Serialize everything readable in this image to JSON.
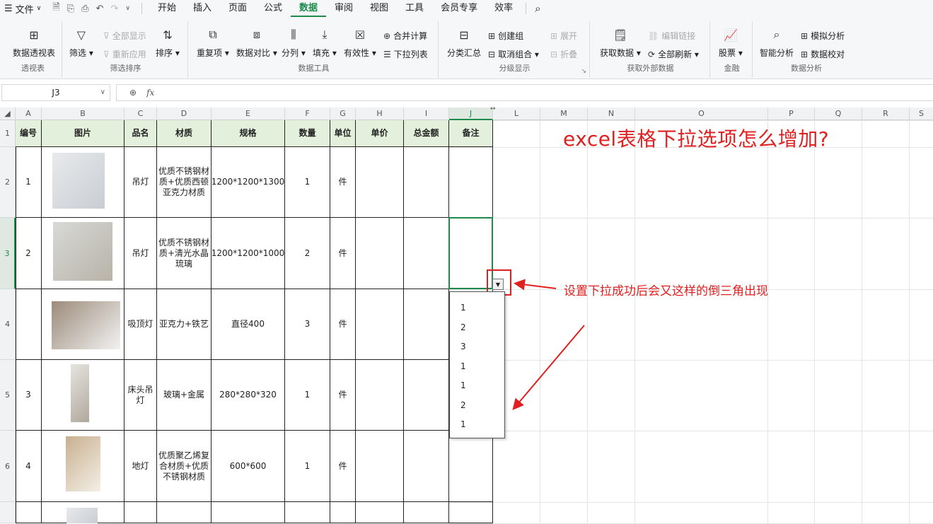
{
  "menubar": {
    "file_label": "文件",
    "tabs": [
      {
        "label": "开始",
        "active": false
      },
      {
        "label": "插入",
        "active": false
      },
      {
        "label": "页面",
        "active": false
      },
      {
        "label": "公式",
        "active": false
      },
      {
        "label": "数据",
        "active": true
      },
      {
        "label": "审阅",
        "active": false
      },
      {
        "label": "视图",
        "active": false
      },
      {
        "label": "工具",
        "active": false
      },
      {
        "label": "会员专享",
        "active": false
      },
      {
        "label": "效率",
        "active": false
      }
    ]
  },
  "ribbon": {
    "groups": {
      "pivot": "透视表",
      "filter_sort": "筛选排序",
      "data_tools": "数据工具",
      "outline": "分级显示",
      "external": "获取外部数据",
      "finance": "金融",
      "analysis": "数据分析"
    },
    "buttons": {
      "pivot_table": "数据透视表",
      "filter": "筛选",
      "show_all": "全部显示",
      "reapply": "重新应用",
      "sort": "排序",
      "duplicates": "重复项",
      "compare": "数据对比",
      "split": "分列",
      "fill": "填充",
      "validity": "有效性",
      "consolidate": "合并计算",
      "dropdown_list": "下拉列表",
      "subtotal": "分类汇总",
      "create_group": "创建组",
      "ungroup": "取消组合",
      "expand": "展开",
      "collapse": "折叠",
      "get_data": "获取数据",
      "edit_links": "编辑链接",
      "refresh_all": "全部刷新",
      "stocks": "股票",
      "smart_analysis": "智能分析",
      "what_if": "模拟分析",
      "data_check": "数据校对"
    }
  },
  "formula_bar": {
    "name_box": "J3",
    "fx_label": "fx",
    "content": ""
  },
  "columns": [
    "A",
    "B",
    "C",
    "D",
    "E",
    "F",
    "G",
    "H",
    "I",
    "J",
    "L",
    "M",
    "N",
    "O",
    "P",
    "Q",
    "R",
    "S"
  ],
  "rows": [
    "1",
    "2",
    "3",
    "4",
    "5",
    "6"
  ],
  "table": {
    "headers": [
      "编号",
      "图片",
      "品名",
      "材质",
      "规格",
      "数量",
      "单位",
      "单价",
      "总金额",
      "备注"
    ],
    "rows": [
      {
        "no": "1",
        "name": "吊灯",
        "material": "优质不锈钢材质+优质西顿亚克力材质",
        "spec": "1200*1200*1300",
        "qty": "1",
        "unit": "件"
      },
      {
        "no": "2",
        "name": "吊灯",
        "material": "优质不锈钢材质+清光水晶琉璃",
        "spec": "1200*1200*1000",
        "qty": "2",
        "unit": "件"
      },
      {
        "no": "",
        "name": "吸顶灯",
        "material": "亚克力+铁艺",
        "spec": "直径400",
        "qty": "3",
        "unit": "件"
      },
      {
        "no": "3",
        "name": "床头吊灯",
        "material": "玻璃+金属",
        "spec": "280*280*320",
        "qty": "1",
        "unit": "件"
      },
      {
        "no": "4",
        "name": "地灯",
        "material": "优质聚乙烯复合材质+优质不锈钢材质",
        "spec": "600*600",
        "qty": "1",
        "unit": "件"
      }
    ]
  },
  "dropdown_options": [
    "1",
    "2",
    "3",
    "1",
    "1",
    "2",
    "1"
  ],
  "annotations": {
    "title": "excel表格下拉选项怎么增加?",
    "note": "设置下拉成功后会又这样的倒三角出现"
  },
  "colors": {
    "accent": "#1e8a4c",
    "annotation": "#e02020",
    "header_fill": "#e3f0dc"
  }
}
